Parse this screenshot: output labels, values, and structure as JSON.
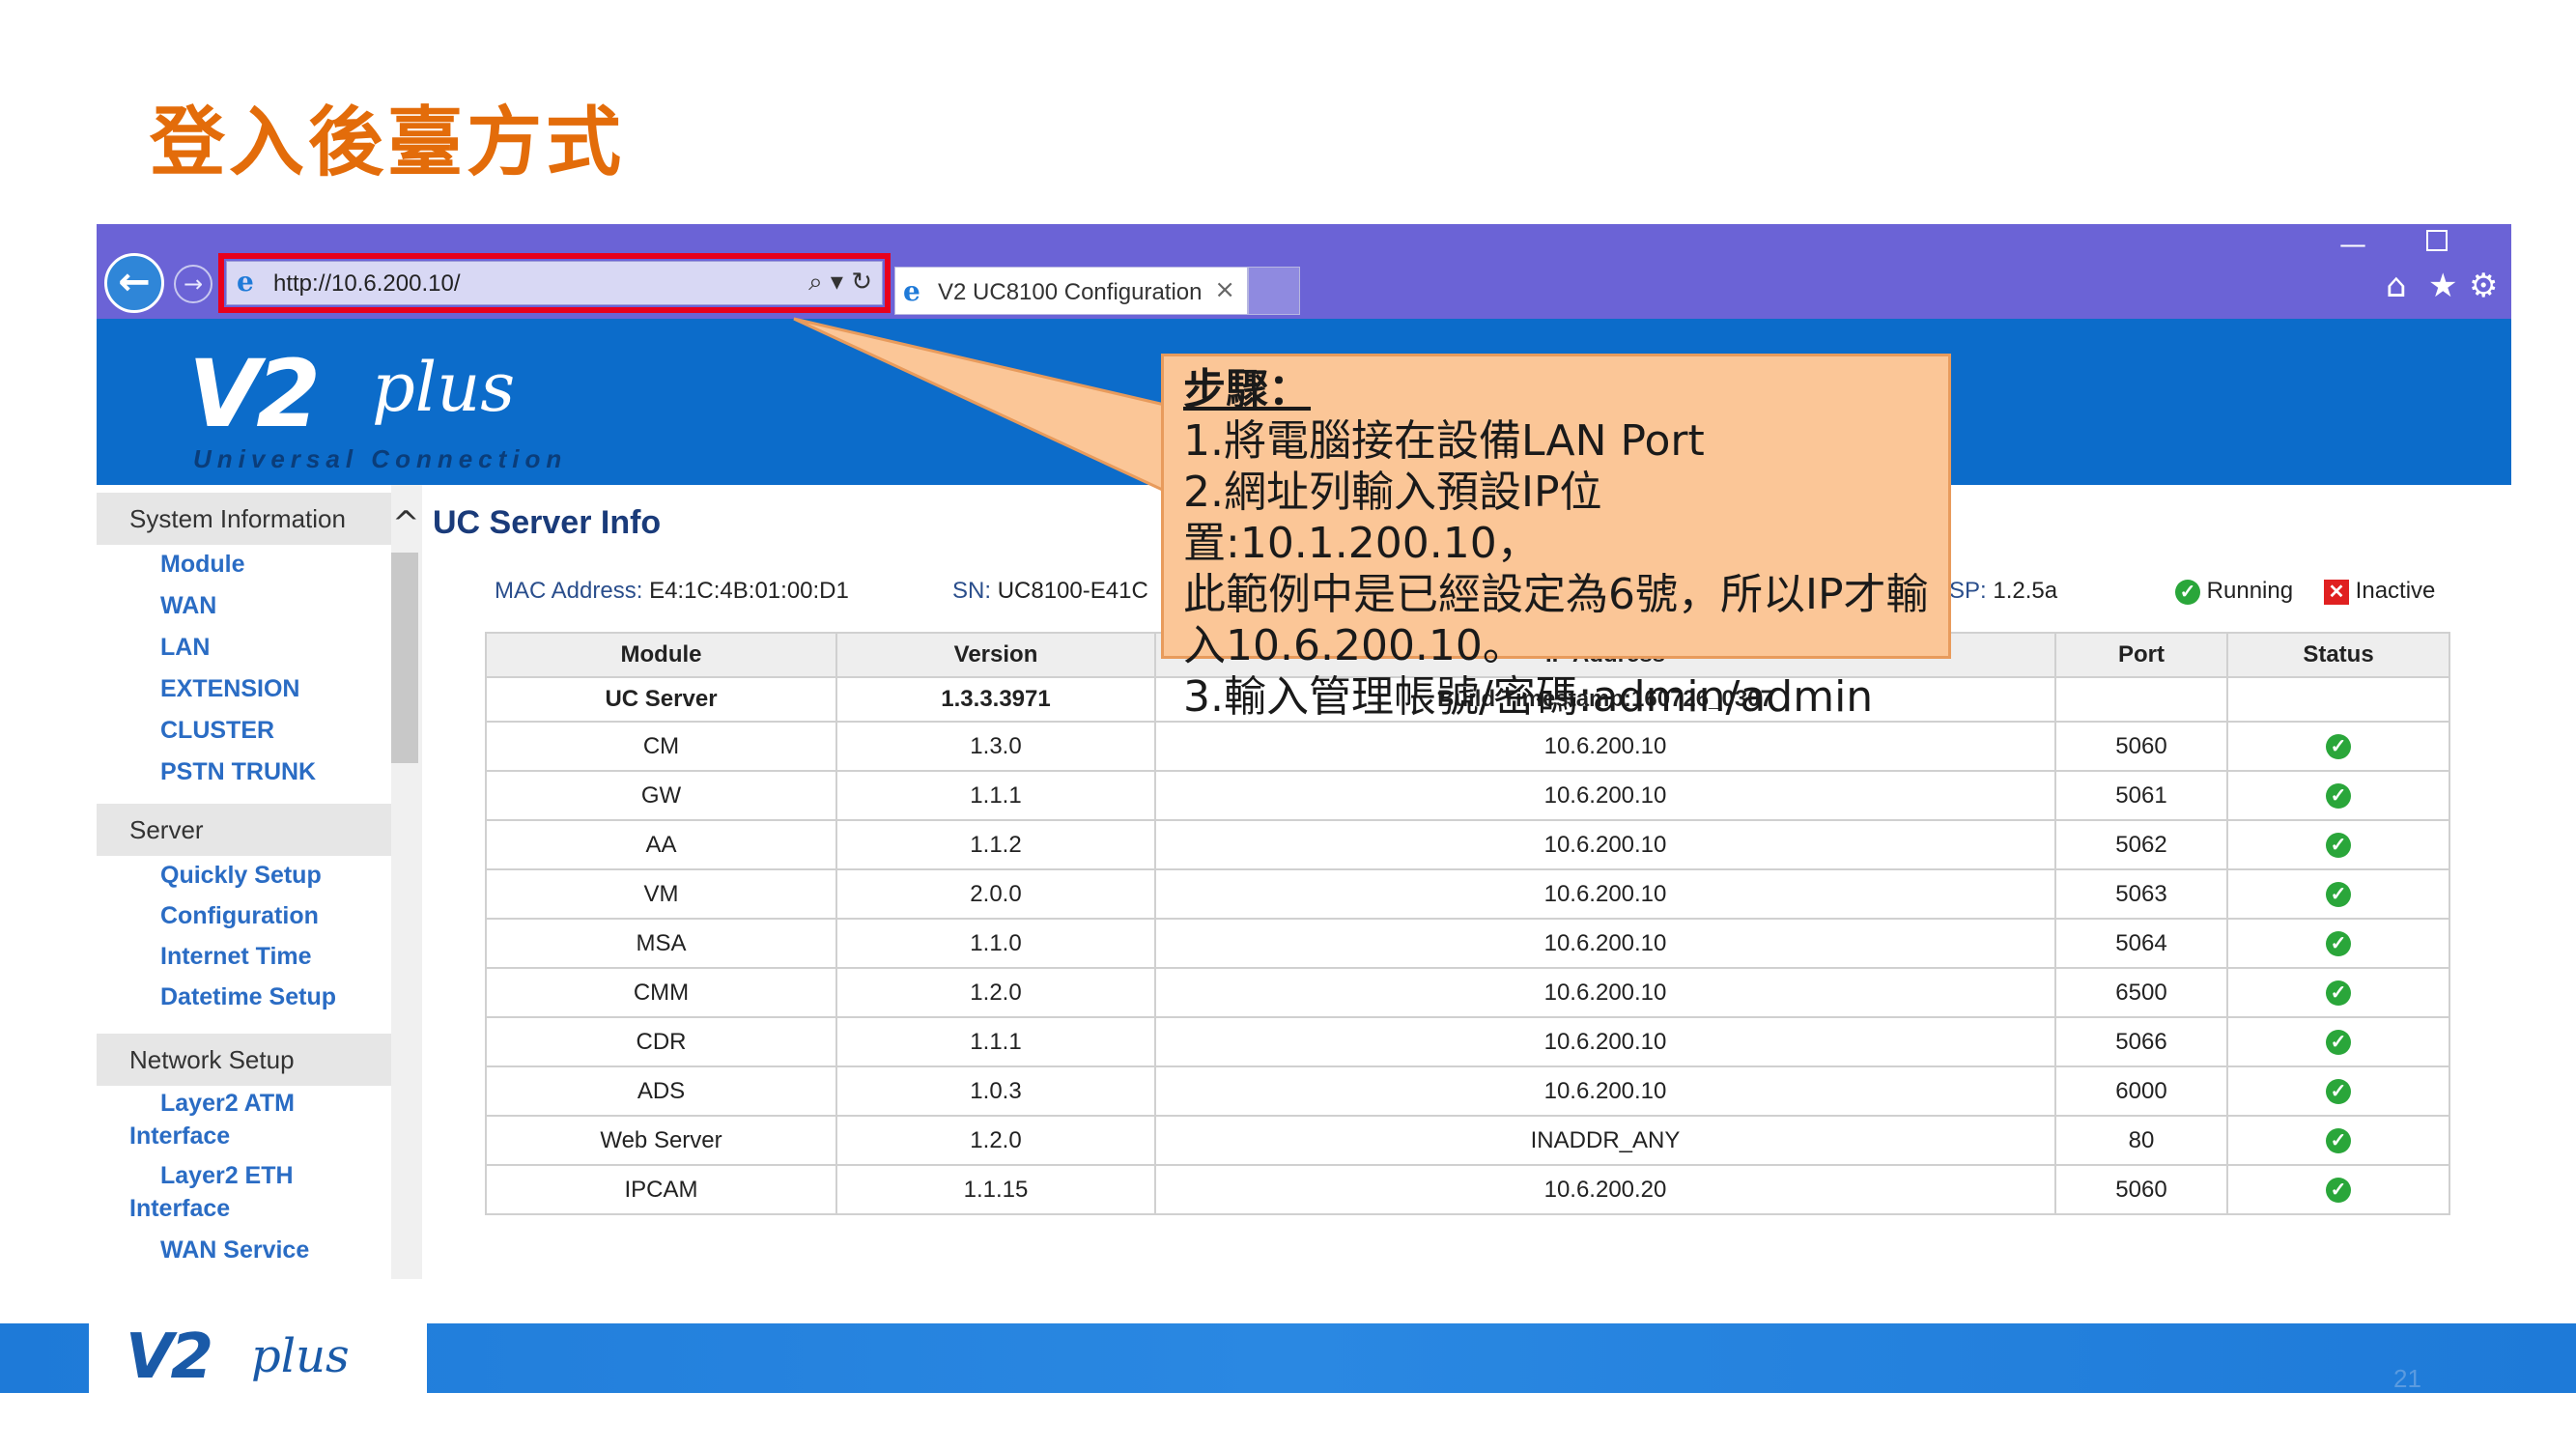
{
  "slide": {
    "title": "登入後臺方式",
    "page_number": "21"
  },
  "browser": {
    "url": "http://10.6.200.10/",
    "tab_title": "V2 UC8100 Configuration",
    "tab_close": "×",
    "address_tools": "⌕ ▾ ↻",
    "back_glyph": "←",
    "forward_glyph": "→",
    "minimize_glyph": "—",
    "icons": [
      "ie-icon",
      "home-icon",
      "star-icon",
      "gear-icon"
    ]
  },
  "banner": {
    "logo": "V2plus",
    "logo_v2": "V2",
    "logo_plus": "plus",
    "tagline": "Universal Connection"
  },
  "sidebar": {
    "sections": [
      {
        "title": "System Information",
        "items": [
          "Module",
          "WAN",
          "LAN",
          "EXTENSION",
          "CLUSTER",
          "PSTN TRUNK"
        ]
      },
      {
        "title": "Server",
        "items": [
          "Quickly Setup",
          "Configuration",
          "Internet Time",
          "Datetime Setup"
        ]
      },
      {
        "title": "Network Setup",
        "items": [
          "Layer2 ATM Interface",
          "Layer2 ETH Interface",
          "WAN Service"
        ]
      }
    ]
  },
  "main": {
    "title": "UC Server Info",
    "collapse_glyph": "^",
    "mac_label": "MAC Address:",
    "mac_value": "E4:1C:4B:01:00:D1",
    "sn_label": "SN:",
    "sn_value": "UC8100-E41C",
    "sp_label": "SP:",
    "sp_value": "1.2.5a",
    "legend_running": "Running",
    "legend_inactive": "Inactive",
    "table": {
      "headers": [
        "Module",
        "Version",
        "IP Address",
        "Port",
        "Status"
      ],
      "summary_row": {
        "module": "UC Server",
        "version": "1.3.3.3971",
        "ip": "Build Timestamp:160726_0307",
        "port": "",
        "status": ""
      },
      "rows": [
        {
          "module": "CM",
          "version": "1.3.0",
          "ip": "10.6.200.10",
          "port": "5060",
          "status": "running"
        },
        {
          "module": "GW",
          "version": "1.1.1",
          "ip": "10.6.200.10",
          "port": "5061",
          "status": "running"
        },
        {
          "module": "AA",
          "version": "1.1.2",
          "ip": "10.6.200.10",
          "port": "5062",
          "status": "running"
        },
        {
          "module": "VM",
          "version": "2.0.0",
          "ip": "10.6.200.10",
          "port": "5063",
          "status": "running"
        },
        {
          "module": "MSA",
          "version": "1.1.0",
          "ip": "10.6.200.10",
          "port": "5064",
          "status": "running"
        },
        {
          "module": "CMM",
          "version": "1.2.0",
          "ip": "10.6.200.10",
          "port": "6500",
          "status": "running"
        },
        {
          "module": "CDR",
          "version": "1.1.1",
          "ip": "10.6.200.10",
          "port": "5066",
          "status": "running"
        },
        {
          "module": "ADS",
          "version": "1.0.3",
          "ip": "10.6.200.10",
          "port": "6000",
          "status": "running"
        },
        {
          "module": "Web Server",
          "version": "1.2.0",
          "ip": "INADDR_ANY",
          "port": "80",
          "status": "running"
        },
        {
          "module": "IPCAM",
          "version": "1.1.15",
          "ip": "10.6.200.20",
          "port": "5060",
          "status": "running"
        }
      ]
    }
  },
  "callout": {
    "heading": "步驟：",
    "lines": [
      "1.將電腦接在設備LAN Port",
      "2.網址列輸入預設IP位置:10.1.200.10，",
      "此範例中是已經設定為6號，所以IP才輸",
      "入10.6.200.10。",
      "3.輸入管理帳號/密碼:admin/admin"
    ]
  },
  "footer": {
    "logo": "V2plus",
    "logo_v2": "V2",
    "logo_plus": "plus"
  },
  "colors": {
    "title": "#e36c0a",
    "chrome": "#6b63d6",
    "banner": "#0c6cca",
    "highlight": "#e8001c",
    "callout": "#fbc697",
    "link": "#2a6cc4",
    "ok": "#2aa63a"
  }
}
